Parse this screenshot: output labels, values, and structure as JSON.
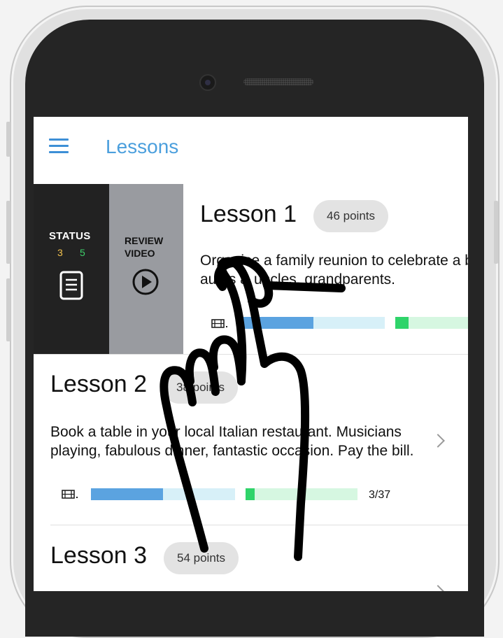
{
  "app": {
    "title": "Lessons"
  },
  "status_panel": {
    "label": "STATUS",
    "count_a": "3",
    "count_b": "5"
  },
  "review_panel": {
    "label_line1": "REVIEW",
    "label_line2": "VIDEO"
  },
  "lessons": [
    {
      "title": "Lesson 1",
      "points": "46 points",
      "description": "Organise a family reunion to celebrate a birthday. Invite your aunts & uncles, grandparents.",
      "video_progress": 0.5,
      "task_progress": 0.12
    },
    {
      "title": "Lesson 2",
      "points": "38 points",
      "description": "Book a table in your local Italian restaurant. Musicians playing, fabulous dinner, fantastic occasion. Pay the bill.",
      "video_progress": 0.5,
      "task_progress": 0.08,
      "count": "3/37"
    },
    {
      "title": "Lesson 3",
      "points": "54 points"
    }
  ],
  "colors": {
    "accent": "#4b9fdd",
    "video_fill": "#5ba3e0",
    "video_track": "#d7f0f8",
    "task_fill": "#2fd46a",
    "task_track": "#d6f7e1",
    "status_a": "#f2c14e",
    "status_b": "#3ecf6a"
  }
}
